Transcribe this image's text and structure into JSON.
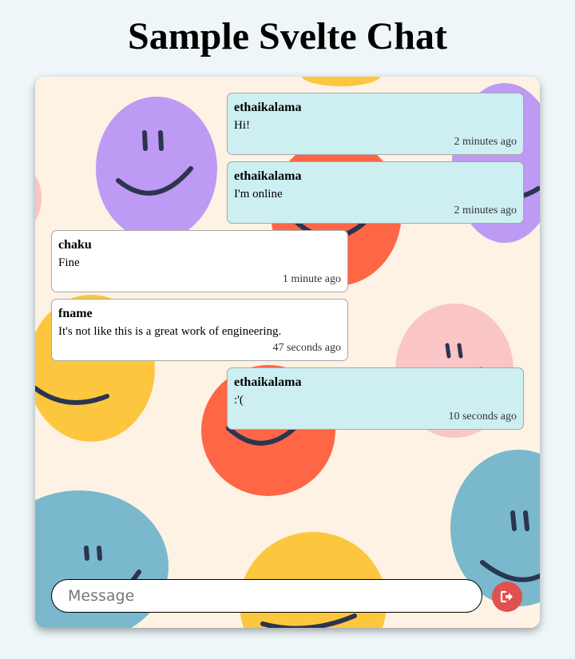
{
  "header": {
    "title": "Sample Svelte Chat"
  },
  "messages": [
    {
      "author": "ethaikalama",
      "text": "Hi!",
      "time": "2 minutes ago",
      "own": true
    },
    {
      "author": "ethaikalama",
      "text": "I'm online",
      "time": "2 minutes ago",
      "own": true
    },
    {
      "author": "chaku",
      "text": "Fine",
      "time": "1 minute ago",
      "own": false
    },
    {
      "author": "fname",
      "text": "It's not like this is a great work of engineering.",
      "time": "47 seconds ago",
      "own": false
    },
    {
      "author": "ethaikalama",
      "text": ":'(",
      "time": "10 seconds ago",
      "own": true
    }
  ],
  "composer": {
    "placeholder": "Message",
    "value": ""
  },
  "send_button": {
    "icon": "logout-arrow-icon",
    "color": "#e0504f"
  },
  "colors": {
    "own_bubble": "#cdeff1",
    "other_bubble": "#ffffff",
    "wallpaper": "#fdf2e3"
  }
}
